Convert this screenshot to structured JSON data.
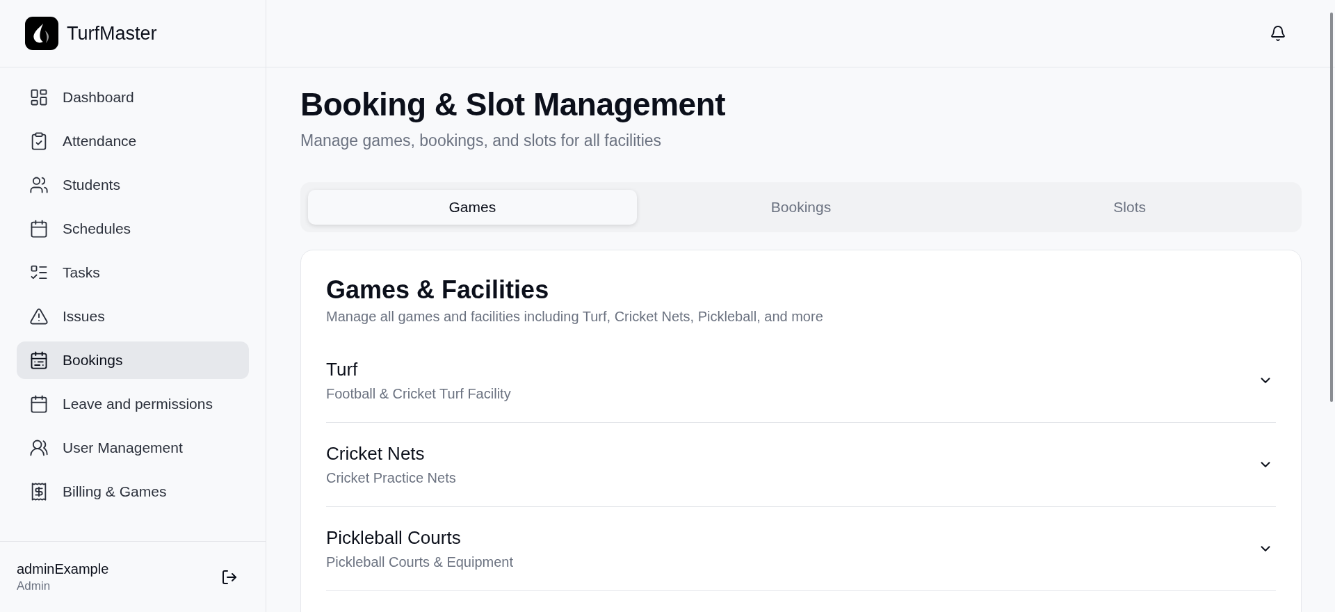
{
  "brand": {
    "name": "TurfMaster"
  },
  "sidebar": {
    "items": [
      {
        "label": "Dashboard",
        "selected": false
      },
      {
        "label": "Attendance",
        "selected": false
      },
      {
        "label": "Students",
        "selected": false
      },
      {
        "label": "Schedules",
        "selected": false
      },
      {
        "label": "Tasks",
        "selected": false
      },
      {
        "label": "Issues",
        "selected": false
      },
      {
        "label": "Bookings",
        "selected": true
      },
      {
        "label": "Leave and permissions",
        "selected": false
      },
      {
        "label": "User Management",
        "selected": false
      },
      {
        "label": "Billing & Games",
        "selected": false
      }
    ]
  },
  "user": {
    "name": "adminExample",
    "role": "Admin"
  },
  "page": {
    "title": "Booking & Slot Management",
    "subtitle": "Manage games, bookings, and slots for all facilities"
  },
  "tabs": [
    {
      "label": "Games",
      "selected": true
    },
    {
      "label": "Bookings",
      "selected": false
    },
    {
      "label": "Slots",
      "selected": false
    }
  ],
  "card": {
    "title": "Games & Facilities",
    "description": "Manage all games and facilities including Turf, Cricket Nets, Pickleball, and more",
    "items": [
      {
        "name": "Turf",
        "description": "Football & Cricket Turf Facility",
        "expanded": false
      },
      {
        "name": "Cricket Nets",
        "description": "Cricket Practice Nets",
        "expanded": false
      },
      {
        "name": "Pickleball Courts",
        "description": "Pickleball Courts & Equipment",
        "expanded": false
      }
    ]
  }
}
